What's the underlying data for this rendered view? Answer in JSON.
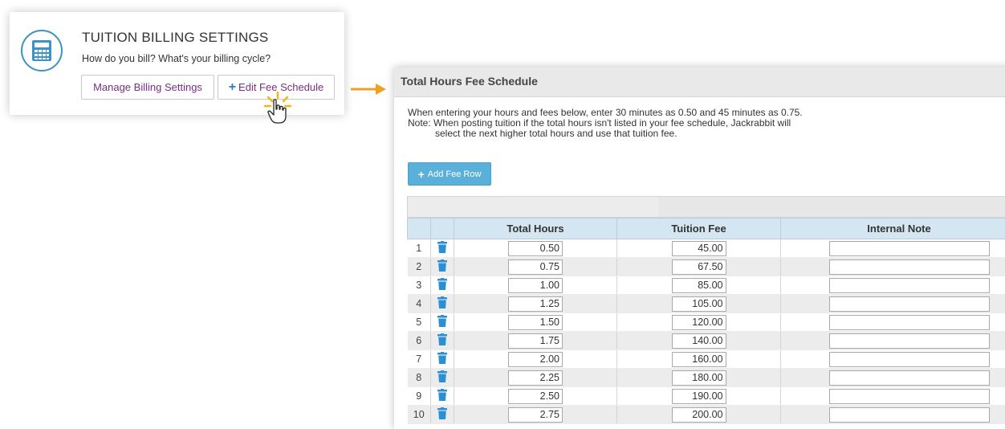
{
  "card": {
    "title": "TUITION BILLING SETTINGS",
    "subtitle": "How do you bill? What's your billing cycle?",
    "manage_label": "Manage Billing Settings",
    "edit_plus": "+",
    "edit_label": "Edit Fee Schedule",
    "icon": "calculator-icon"
  },
  "panel": {
    "title": "Total Hours Fee Schedule",
    "line1": "When entering your hours and fees below, enter 30 minutes as 0.50 and 45 minutes as 0.75.",
    "line2": "Note: When posting tuition if the total hours isn't listed in your fee schedule, Jackrabbit will",
    "line3": "select the next higher total hours and use that tuition fee.",
    "add_plus": "+",
    "add_label": "Add Fee Row"
  },
  "table": {
    "headers": [
      "Total Hours",
      "Tuition Fee",
      "Internal Note"
    ],
    "rows": [
      {
        "n": "1",
        "hours": "0.50",
        "fee": "45.00"
      },
      {
        "n": "2",
        "hours": "0.75",
        "fee": "67.50"
      },
      {
        "n": "3",
        "hours": "1.00",
        "fee": "85.00"
      },
      {
        "n": "4",
        "hours": "1.25",
        "fee": "105.00"
      },
      {
        "n": "5",
        "hours": "1.50",
        "fee": "120.00"
      },
      {
        "n": "6",
        "hours": "1.75",
        "fee": "140.00"
      },
      {
        "n": "7",
        "hours": "2.00",
        "fee": "160.00"
      },
      {
        "n": "8",
        "hours": "2.25",
        "fee": "180.00"
      },
      {
        "n": "9",
        "hours": "2.50",
        "fee": "190.00"
      },
      {
        "n": "10",
        "hours": "2.75",
        "fee": "200.00"
      }
    ]
  },
  "colors": {
    "accent_blue": "#3b93c8",
    "button_purple_text": "#7a2f84",
    "arrow_orange": "#f0a020",
    "add_button_bg": "#5bb0d9",
    "header_blue": "#d5e6f3",
    "trash_blue": "#2a8fd3"
  }
}
